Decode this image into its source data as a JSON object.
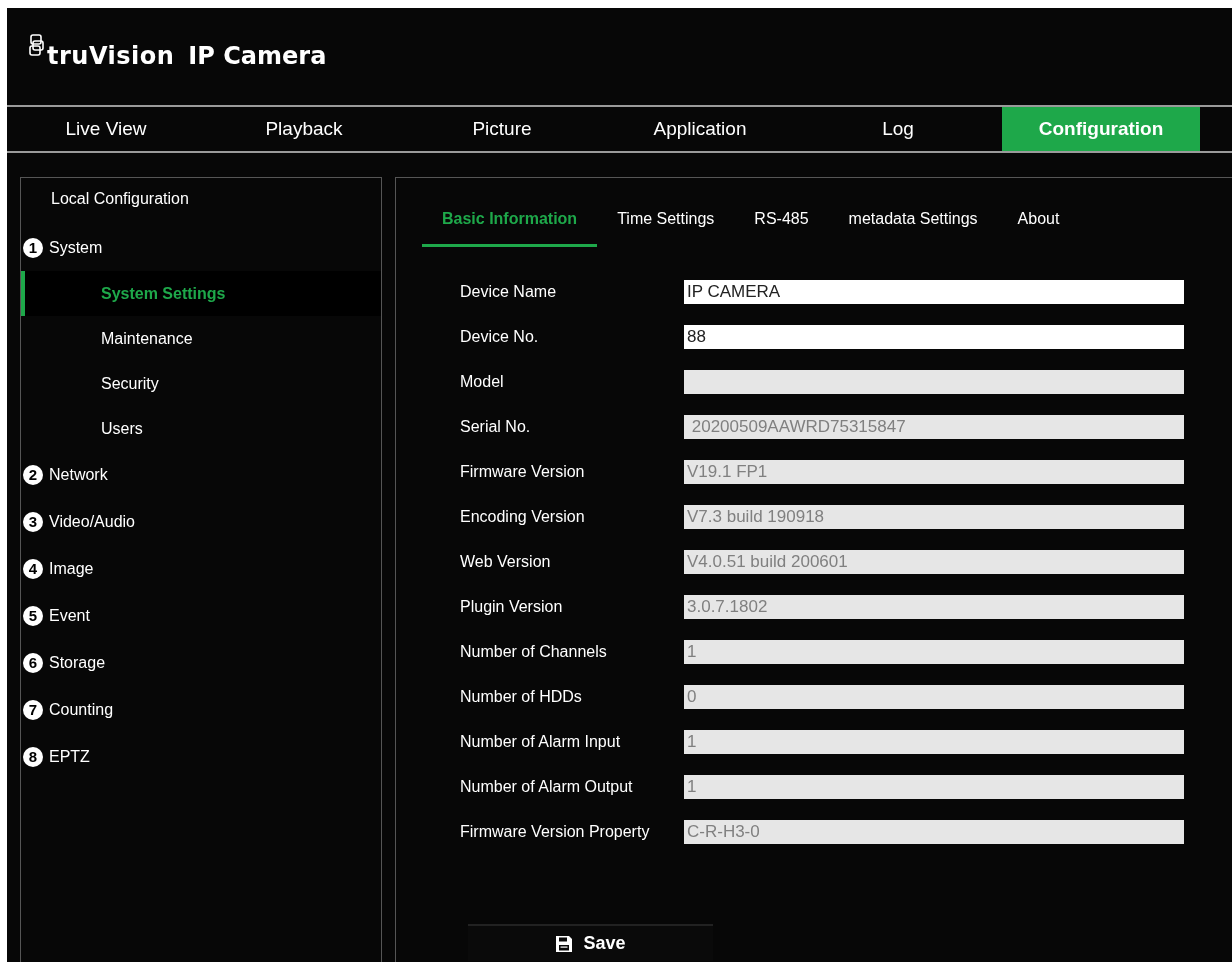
{
  "header": {
    "logo_text": "truVision",
    "title": "IP Camera"
  },
  "nav_tabs": [
    {
      "label": "Live View",
      "selected": false
    },
    {
      "label": "Playback",
      "selected": false
    },
    {
      "label": "Picture",
      "selected": false
    },
    {
      "label": "Application",
      "selected": false
    },
    {
      "label": "Log",
      "selected": false
    },
    {
      "label": "Configuration",
      "selected": true
    }
  ],
  "sidebar": {
    "title": "Local Configuration",
    "items": [
      {
        "marker": "1",
        "label": "System",
        "selected": false,
        "children": [
          {
            "label": "System Settings",
            "selected": true
          },
          {
            "label": "Maintenance",
            "selected": false
          },
          {
            "label": "Security",
            "selected": false
          },
          {
            "label": "Users",
            "selected": false
          }
        ]
      },
      {
        "marker": "2",
        "label": "Network",
        "selected": false
      },
      {
        "marker": "3",
        "label": "Video/Audio",
        "selected": false
      },
      {
        "marker": "4",
        "label": "Image",
        "selected": false
      },
      {
        "marker": "5",
        "label": "Event",
        "selected": false
      },
      {
        "marker": "6",
        "label": "Storage",
        "selected": false
      },
      {
        "marker": "7",
        "label": "Counting",
        "selected": false
      },
      {
        "marker": "8",
        "label": "EPTZ",
        "selected": false
      }
    ]
  },
  "sub_tabs": [
    {
      "label": "Basic Information",
      "selected": true
    },
    {
      "label": "Time Settings",
      "selected": false
    },
    {
      "label": "RS-485",
      "selected": false
    },
    {
      "label": "metadata Settings",
      "selected": false
    },
    {
      "label": "About",
      "selected": false
    }
  ],
  "fields": [
    {
      "label": "Device Name",
      "value": "IP CAMERA",
      "disabled": false
    },
    {
      "label": "Device No.",
      "value": "88",
      "disabled": false
    },
    {
      "label": "Model",
      "disabled": true
    },
    {
      "label": "Serial No.",
      "value": " 20200509AAWRD75315847",
      "disabled": true
    },
    {
      "label": "Firmware Version",
      "value": "V19.1 FP1",
      "disabled": true
    },
    {
      "label": "Encoding Version",
      "value": "V7.3 build 190918",
      "disabled": true
    },
    {
      "label": "Web Version",
      "value": "V4.0.51 build 200601",
      "disabled": true
    },
    {
      "label": "Plugin Version",
      "value": "3.0.7.1802",
      "disabled": true
    },
    {
      "label": "Number of Channels",
      "value": "1",
      "disabled": true
    },
    {
      "label": "Number of HDDs",
      "value": "0",
      "disabled": true
    },
    {
      "label": "Number of Alarm Input",
      "value": "1",
      "disabled": true
    },
    {
      "label": "Number of Alarm Output",
      "value": "1",
      "disabled": true
    },
    {
      "label": "Firmware Version Property",
      "value": "C-R-H3-0",
      "disabled": true
    }
  ],
  "save_button": {
    "label": "Save"
  }
}
